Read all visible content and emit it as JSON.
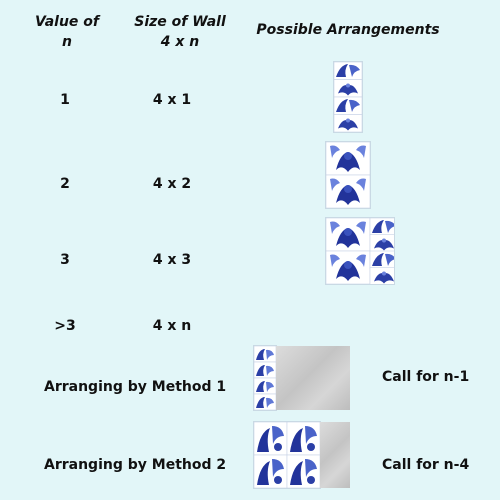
{
  "headers": {
    "value_of_n": "Value of n",
    "size_of_wall": "Size of Wall 4 x n",
    "possible_arrangements": "Possible Arrangements"
  },
  "rows": [
    {
      "n": "1",
      "size": "4 x 1"
    },
    {
      "n": "2",
      "size": "4 x 2"
    },
    {
      "n": "3",
      "size": "4 x 3"
    },
    {
      "n": ">3",
      "size": "4 x n"
    }
  ],
  "methods": [
    {
      "label": "Arranging by Method 1",
      "call": "Call for n-1"
    },
    {
      "label": "Arranging by Method 2",
      "call": "Call for n-4"
    }
  ],
  "colors": {
    "background": "#e2f6f8",
    "tile_blue": "#2b3fa6",
    "tile_light_blue": "#5f78d6",
    "gray_placeholder": "#c8c8c8"
  }
}
